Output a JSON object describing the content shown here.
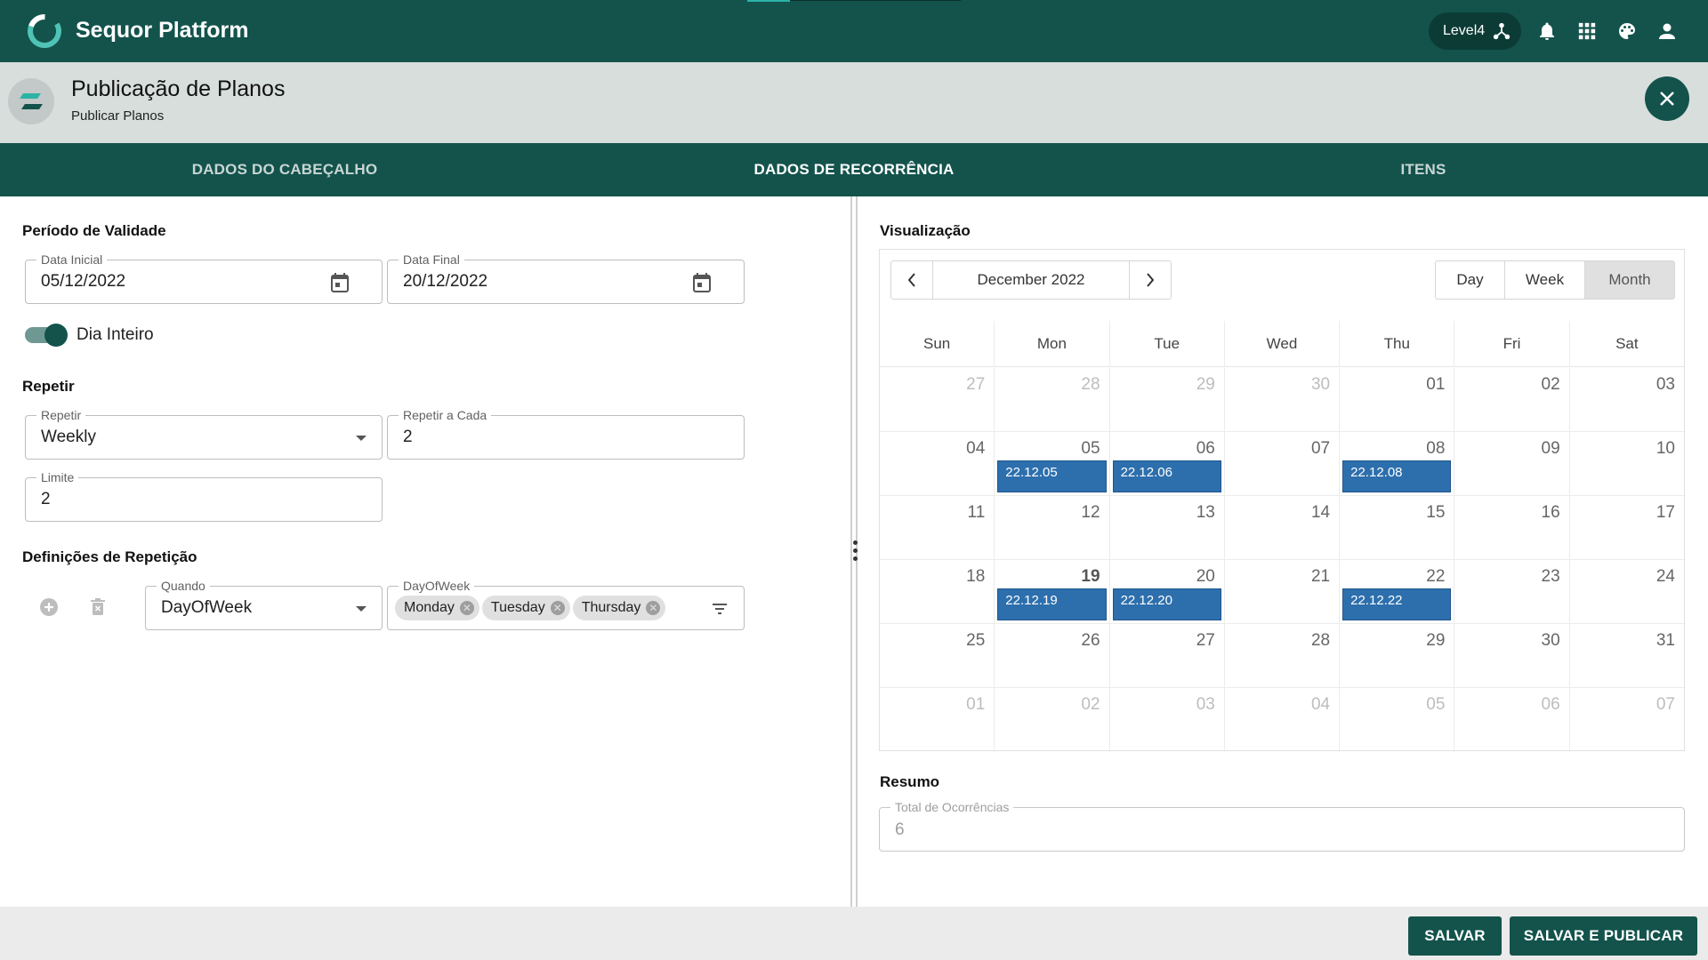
{
  "app": {
    "title": "Sequor Platform",
    "level": "Level4"
  },
  "header": {
    "title": "Publicação de Planos",
    "subtitle": "Publicar Planos"
  },
  "tabs": [
    {
      "label": "DADOS DO CABEÇALHO",
      "active": false
    },
    {
      "label": "DADOS DE RECORRÊNCIA",
      "active": true
    },
    {
      "label": "ITENS",
      "active": false
    }
  ],
  "validity": {
    "title": "Período de Validade",
    "start": {
      "label": "Data Inicial",
      "value": "05/12/2022"
    },
    "end": {
      "label": "Data Final",
      "value": "20/12/2022"
    },
    "all_day": {
      "label": "Dia Inteiro",
      "on": true
    }
  },
  "repeat": {
    "title": "Repetir",
    "repeat": {
      "label": "Repetir",
      "value": "Weekly"
    },
    "every": {
      "label": "Repetir a Cada",
      "value": "2"
    },
    "limit": {
      "label": "Limite",
      "value": "2"
    }
  },
  "repeat_defs": {
    "title": "Definições de Repetição",
    "when": {
      "label": "Quando",
      "value": "DayOfWeek"
    },
    "days": {
      "label": "DayOfWeek",
      "chips": [
        "Monday",
        "Tuesday",
        "Thursday"
      ]
    }
  },
  "preview": {
    "title": "Visualização",
    "month_label": "December 2022",
    "views": [
      "Day",
      "Week",
      "Month"
    ],
    "active_view": "Month",
    "weekdays": [
      "Sun",
      "Mon",
      "Tue",
      "Wed",
      "Thu",
      "Fri",
      "Sat"
    ],
    "weeks": [
      [
        {
          "d": "27",
          "o": true
        },
        {
          "d": "28",
          "o": true
        },
        {
          "d": "29",
          "o": true
        },
        {
          "d": "30",
          "o": true
        },
        {
          "d": "01"
        },
        {
          "d": "02"
        },
        {
          "d": "03"
        }
      ],
      [
        {
          "d": "04"
        },
        {
          "d": "05",
          "e": "22.12.05"
        },
        {
          "d": "06",
          "e": "22.12.06"
        },
        {
          "d": "07"
        },
        {
          "d": "08",
          "e": "22.12.08"
        },
        {
          "d": "09"
        },
        {
          "d": "10"
        }
      ],
      [
        {
          "d": "11"
        },
        {
          "d": "12"
        },
        {
          "d": "13"
        },
        {
          "d": "14"
        },
        {
          "d": "15"
        },
        {
          "d": "16"
        },
        {
          "d": "17"
        }
      ],
      [
        {
          "d": "18"
        },
        {
          "d": "19",
          "t": true,
          "e": "22.12.19"
        },
        {
          "d": "20",
          "e": "22.12.20"
        },
        {
          "d": "21"
        },
        {
          "d": "22",
          "e": "22.12.22"
        },
        {
          "d": "23"
        },
        {
          "d": "24"
        }
      ],
      [
        {
          "d": "25"
        },
        {
          "d": "26"
        },
        {
          "d": "27"
        },
        {
          "d": "28"
        },
        {
          "d": "29"
        },
        {
          "d": "30"
        },
        {
          "d": "31"
        }
      ],
      [
        {
          "d": "01",
          "o": true
        },
        {
          "d": "02",
          "o": true
        },
        {
          "d": "03",
          "o": true
        },
        {
          "d": "04",
          "o": true
        },
        {
          "d": "05",
          "o": true
        },
        {
          "d": "06",
          "o": true
        },
        {
          "d": "07",
          "o": true
        }
      ]
    ]
  },
  "summary": {
    "title": "Resumo",
    "total_label": "Total de Ocorrências",
    "total_value": "6"
  },
  "footer": {
    "save": "SALVAR",
    "save_publish": "SALVAR E PUBLICAR"
  }
}
